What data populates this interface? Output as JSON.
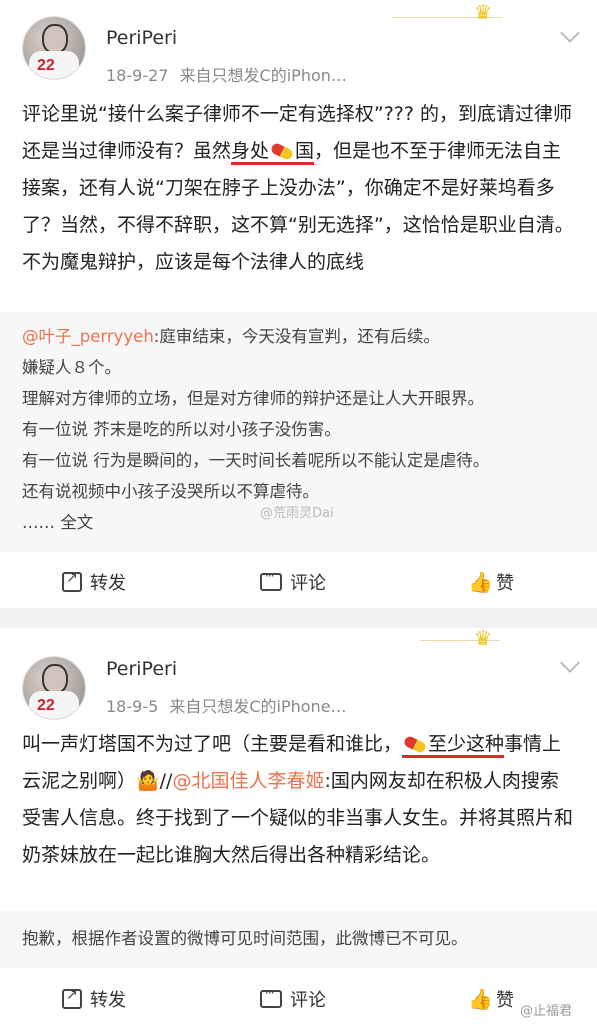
{
  "posts": [
    {
      "username": "PeriPeri",
      "date": "18-9-27",
      "source": "来自只想发C的iPhon…",
      "text_before": "评论里说“接什么案子律师不一定有选择权”??? 的，到底请过律师还是当过律师没有？虽然",
      "text_underlined": "身处",
      "text_underlined_after": "国",
      "text_after": "，但是也不至于律师无法自主接案，还有人说“刀架在脖子上没办法”，你确定不是好莱坞看多了？当然，不得不辞职，这不算“别无选择”，这恰恰是职业自清。不为魔鬼辩护，应该是每个法律人的底线",
      "original": {
        "mention": "@叶子_perryyeh",
        "lines": [
          ":庭审结束，今天没有宣判，还有后续。",
          "嫌疑人８个。",
          "理解对方律师的立场，但是对方律师的辩护还是让人大开眼界。",
          "有一位说 芥末是吃的所以对小孩子没伤害。",
          "有一位说 行为是瞬间的，一天时间长着呢所以不能认定是虐待。",
          "还有说视频中小孩子没哭所以不算虐待。",
          "…… 全文"
        ],
        "watermark": "@荒雨灵Dai"
      },
      "actions": {
        "repost": "转发",
        "comment": "评论",
        "like": "赞"
      }
    },
    {
      "username": "PeriPeri",
      "date": "18-9-5",
      "source": "来自只想发C的iPhone…",
      "text_before": "叫一声灯塔国不为过了吧（主要是看和谁比，",
      "text_underlined": "至少这种",
      "text_after": "事情上云泥之别啊）🤷//",
      "mention": "@北国佳人李春姬",
      "text_tail": ":国内网友却在积极人肉搜索受害人信息。终于找到了一个疑似的非当事人女生。并将其照片和奶茶妹放在一起比谁胸大然后得出各种精彩结论。",
      "original_unavailable": "抱歉，根据作者设置的微博可见时间范围，此微博已不可见。",
      "actions": {
        "repost": "转发",
        "comment": "评论",
        "like": "赞"
      },
      "watermark": "@止福君"
    }
  ]
}
